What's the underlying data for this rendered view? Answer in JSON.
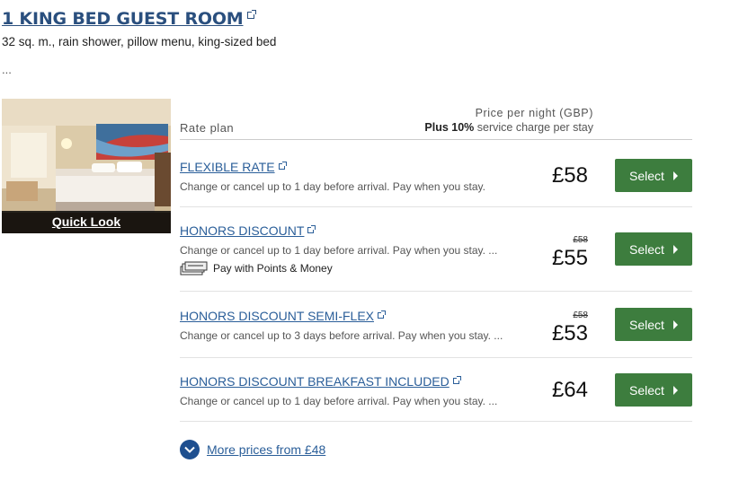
{
  "room": {
    "title": "1 KING BED GUEST ROOM",
    "description": "32 sq. m., rain shower, pillow menu, king-sized bed",
    "more": "...",
    "quick_look": "Quick Look"
  },
  "table_header": {
    "rate_plan": "Rate plan",
    "price_per_night": "Price per night (GBP)",
    "service_prefix": "Plus 10%",
    "service_suffix": " service charge per stay"
  },
  "rates": [
    {
      "name": "FLEXIBLE RATE",
      "description": "Change or cancel up to 1 day before arrival. Pay when you stay.",
      "price": "£58",
      "select": "Select"
    },
    {
      "name": "HONORS DISCOUNT",
      "description": "Change or cancel up to 1 day before arrival. Pay when you stay. ...",
      "points_label": "Pay with Points & Money",
      "old_price": "£58",
      "price": "£55",
      "select": "Select"
    },
    {
      "name": "HONORS DISCOUNT SEMI-FLEX",
      "description": "Change or cancel up to 3 days before arrival. Pay when you stay. ...",
      "old_price": "£58",
      "price": "£53",
      "select": "Select"
    },
    {
      "name": "HONORS DISCOUNT BREAKFAST INCLUDED",
      "description": "Change or cancel up to 1 day before arrival. Pay when you stay. ...",
      "price": "£64",
      "select": "Select"
    }
  ],
  "more_prices": "More prices from £48",
  "colors": {
    "select_green": "#3d7d3e",
    "link_blue": "#2a5e99",
    "title_blue": "#2a4f7e",
    "more_circle": "#1e4f8f"
  },
  "icons": [
    "external-link-icon",
    "chevron-right-icon",
    "points-money-icon",
    "chevron-down-icon"
  ]
}
